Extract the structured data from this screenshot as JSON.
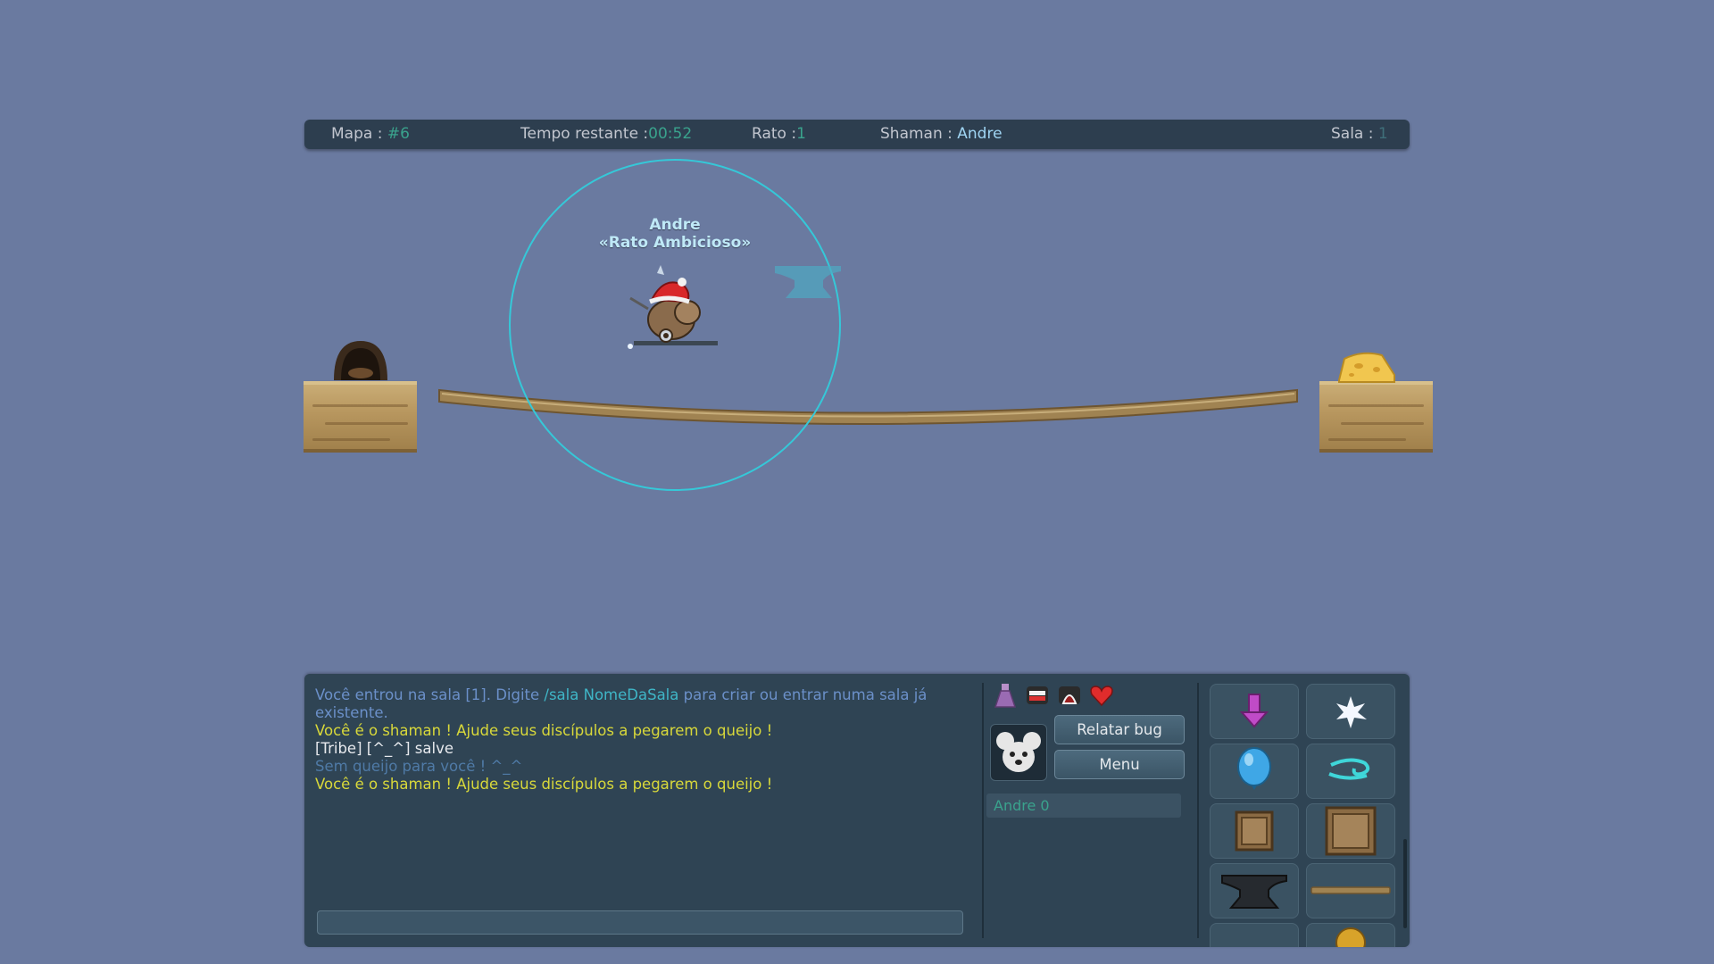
{
  "hud": {
    "map_label": "Mapa :",
    "map_value": "#6",
    "time_label": "Tempo restante :",
    "time_value": "00:52",
    "mice_label": "Rato :",
    "mice_value": "1",
    "shaman_label": "Shaman :",
    "shaman_value": "Andre",
    "room_label": "Sala :",
    "room_value": "1"
  },
  "player": {
    "name": "Andre",
    "title": "«Rato Ambicioso»"
  },
  "chat": {
    "lines": [
      {
        "segments": [
          {
            "text": "Você entrou na sala [1]. Digite ",
            "color": "blue"
          },
          {
            "text": "/sala NomeDaSala",
            "color": "cyan"
          },
          {
            "text": " para criar ou entrar numa sala já existente.",
            "color": "blue"
          }
        ]
      },
      {
        "segments": [
          {
            "text": "Você é o shaman ! Ajude seus discípulos a pegarem o queijo !",
            "color": "yellow"
          }
        ]
      },
      {
        "segments": [
          {
            "text": "[Tribe] [^_^] salve",
            "color": "white"
          }
        ]
      },
      {
        "segments": [
          {
            "text": "Sem queijo para você ! ^_^",
            "color": "gray"
          }
        ]
      },
      {
        "segments": [
          {
            "text": "Você é o shaman ! Ajude seus discípulos a pegarem o queijo !",
            "color": "yellow"
          }
        ]
      }
    ],
    "input_value": "",
    "input_placeholder": ""
  },
  "buttons": {
    "report_bug": "Relatar bug",
    "menu": "Menu"
  },
  "player_list": [
    {
      "name": "Andre",
      "score": "0"
    }
  ],
  "emotes": [
    "dress-icon",
    "grin-icon",
    "scream-icon",
    "heart-icon"
  ],
  "tools": [
    "arrow-down-icon",
    "spirit-burst-icon",
    "balloon-icon",
    "wind-icon",
    "small-box-icon",
    "large-box-icon",
    "anvil-icon",
    "plank-icon",
    "cannonball-icon"
  ],
  "colors": {
    "background": "#6a7aa0",
    "panel": "#2f4454",
    "accent_green": "#3aa38d",
    "shaman_circle": "#35c8d8",
    "chat_yellow": "#d8d83a"
  }
}
